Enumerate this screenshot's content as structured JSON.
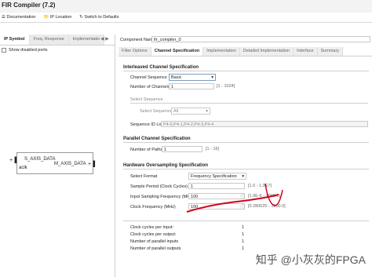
{
  "window": {
    "title": "FIR Compiler (7.2)"
  },
  "toolbar": {
    "documentation": "Documentation",
    "ip_location": "IP Location",
    "switch_defaults": "Switch to Defaults"
  },
  "left": {
    "tabs": [
      "IP Symbol",
      "Freq. Response",
      "Implementatio"
    ],
    "show_disabled_ports": "Show disabled ports",
    "symbol": {
      "port_in": "S_AXIS_DATA",
      "port_out": "M_AXIS_DATA",
      "clk": "aclk"
    }
  },
  "right": {
    "component_name_label": "Component Name",
    "component_name_value": "fir_compiler_0",
    "tabs": [
      "Filter Options",
      "Channel Specification",
      "Implementation",
      "Detailed Implementation",
      "Interface",
      "Summary"
    ],
    "interleaved": {
      "header": "Interleaved Channel Specification",
      "channel_sequence_label": "Channel Sequence",
      "channel_sequence_value": "Basic",
      "number_of_channels_label": "Number of Channels",
      "number_of_channels_value": "1",
      "number_of_channels_hint": "[1 - 1024]",
      "select_sequence_header": "Select Sequence",
      "select_sequence_label": "Select Sequence",
      "select_sequence_value": "All",
      "sequence_id_label": "Sequence ID List",
      "sequence_id_value": "P4-0,P4-1,P4-2,P4-3,P4-4"
    },
    "parallel": {
      "header": "Parallel Channel Specification",
      "number_of_paths_label": "Number of Paths",
      "number_of_paths_value": "1",
      "number_of_paths_hint": "[1 - 16]"
    },
    "oversampling": {
      "header": "Hardware Oversampling Specification",
      "select_format_label": "Select Format",
      "select_format_value": "Frequency Specification",
      "sample_period_label": "Sample Period (Clock Cycles)",
      "sample_period_value": "1",
      "sample_period_hint": "[1.0 - 1.0E7]",
      "input_sampling_label": "Input Sampling Frequency (MHz)",
      "input_sampling_value": "100",
      "input_sampling_hint": "[1.0E-6 - 1000.0]",
      "clock_frequency_label": "Clock Frequency (MHz)",
      "clock_frequency_value": "100",
      "clock_frequency_hint": "[0.280625 - 1000.0]"
    },
    "summary": [
      {
        "label": "Clock cycles per input:",
        "value": "1"
      },
      {
        "label": "Clock cycles per output:",
        "value": "1"
      },
      {
        "label": "Number of parallel inputs",
        "value": "1"
      },
      {
        "label": "Number of parallel outputs",
        "value": "1"
      }
    ]
  },
  "watermark": "知乎 @小灰灰的FPGA",
  "colors": {
    "annotation": "#d0021b",
    "accent": "#3b6fc4"
  }
}
